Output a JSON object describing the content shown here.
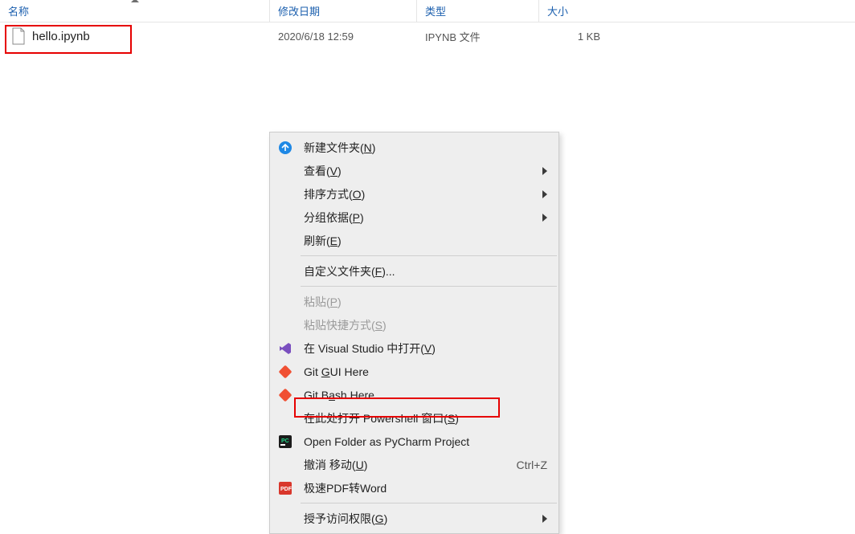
{
  "columns": {
    "name": "名称",
    "date": "修改日期",
    "type": "类型",
    "size": "大小"
  },
  "file": {
    "name": "hello.ipynb",
    "date": "2020/6/18 12:59",
    "type": "IPYNB 文件",
    "size": "1 KB"
  },
  "menu": {
    "new_folder": "新建文件夹(",
    "new_folder_key": "N",
    "new_folder_end": ")",
    "view": "查看(",
    "view_key": "V",
    "view_end": ")",
    "sort": "排序方式(",
    "sort_key": "O",
    "sort_end": ")",
    "group": "分组依据(",
    "group_key": "P",
    "group_end": ")",
    "refresh": "刷新(",
    "refresh_key": "E",
    "refresh_end": ")",
    "customize": "自定义文件夹(",
    "customize_key": "F",
    "customize_end": ")...",
    "paste": "粘贴(",
    "paste_key": "P",
    "paste_end": ")",
    "paste_shortcut": "粘贴快捷方式(",
    "paste_shortcut_key": "S",
    "paste_shortcut_end": ")",
    "open_vs": "在 Visual Studio 中打开(",
    "open_vs_key": "V",
    "open_vs_end": ")",
    "git_gui_pre": "Git ",
    "git_gui_key": "G",
    "git_gui_post": "UI Here",
    "git_bash_pre": "Git B",
    "git_bash_key": "a",
    "git_bash_post": "sh Here",
    "powershell": "在此处打开 Powershell 窗口(",
    "powershell_key": "S",
    "powershell_end": ")",
    "pycharm": "Open Folder as PyCharm Project",
    "undo_move": "撤消 移动(",
    "undo_move_key": "U",
    "undo_move_end": ")",
    "undo_shortcut": "Ctrl+Z",
    "pdf": "极速PDF转Word",
    "grant": "授予访问权限(",
    "grant_key": "G",
    "grant_end": ")"
  }
}
